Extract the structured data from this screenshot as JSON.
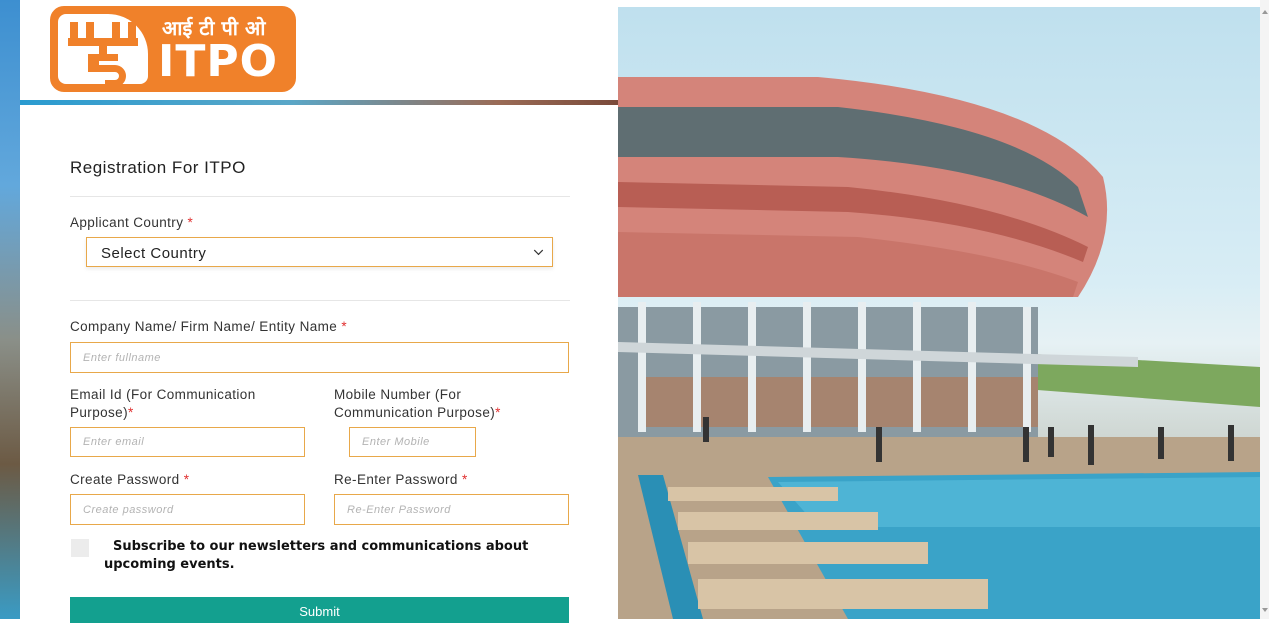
{
  "logo": {
    "hindi_text": "आई टी पी ओ",
    "text": "ITPO"
  },
  "form": {
    "title": "Registration For ITPO",
    "country": {
      "label": "Applicant Country",
      "required_mark": "*",
      "selected": "Select Country"
    },
    "company": {
      "label": "Company Name/ Firm Name/ Entity Name",
      "required_mark": "*",
      "placeholder": "Enter fullname"
    },
    "email": {
      "label_line1": "Email Id (For Communication",
      "label_line2": "Purpose)",
      "required_mark": "*",
      "placeholder": "Enter email"
    },
    "mobile": {
      "label_line1": "Mobile Number (For",
      "label_line2": "Communication Purpose)",
      "required_mark": "*",
      "placeholder": "Enter Mobile"
    },
    "password": {
      "label": "Create Password",
      "required_mark": "*",
      "placeholder": "Create password"
    },
    "repassword": {
      "label": "Re-Enter Password",
      "required_mark": "*",
      "placeholder": "Re-Enter Password"
    },
    "subscribe_text": "Subscribe to our newsletters and communications about upcoming events.",
    "submit_label": "Submit"
  },
  "colors": {
    "brand_orange": "#f0812a",
    "submit_teal": "#13a08f",
    "input_border": "#e8a84a",
    "required_red": "#e03030"
  }
}
